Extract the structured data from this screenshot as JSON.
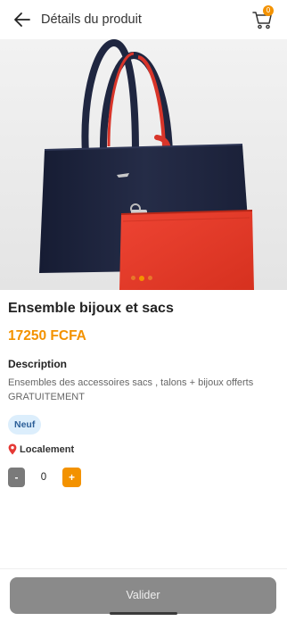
{
  "header": {
    "title": "Détails du produit",
    "back_icon": "arrow-left-icon",
    "cart_icon": "shopping-cart-icon",
    "cart_count": "0"
  },
  "product": {
    "image_icon": "product-photo",
    "carousel_active_index": 2,
    "carousel_dot_count": 3,
    "name": "Ensemble bijoux et sacs",
    "price": "17250 FCFA",
    "description_title": "Description",
    "description": "Ensembles des accessoires sacs , talons + bijoux offerts GRATUITEMENT",
    "condition_badge": "Neuf",
    "location_icon": "location-pin-icon",
    "location": "Localement"
  },
  "quantity": {
    "minus_label": "-",
    "value": "0",
    "plus_label": "+"
  },
  "footer": {
    "validate_label": "Valider"
  },
  "colors": {
    "accent": "#f39200",
    "button_disabled": "#8a8a8a",
    "badge_bg": "#dceefc",
    "bag_navy": "#1f2640",
    "pouch_red": "#e23a2a"
  }
}
